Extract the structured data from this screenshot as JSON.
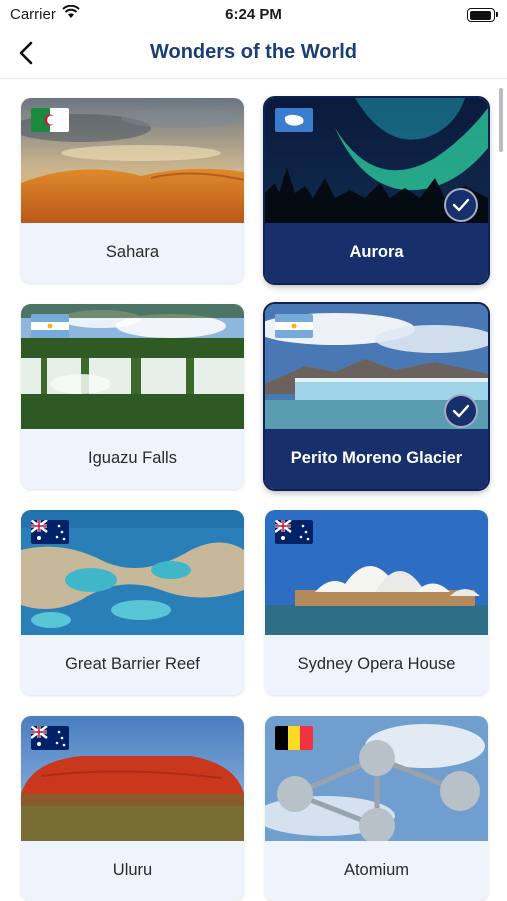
{
  "status_bar": {
    "carrier": "Carrier",
    "time": "6:24 PM"
  },
  "nav": {
    "title": "Wonders of the World"
  },
  "wonders": [
    {
      "label": "Sahara",
      "flag": "algeria-flag",
      "selected": false
    },
    {
      "label": "Aurora",
      "flag": "antarctica-flag",
      "selected": true
    },
    {
      "label": "Iguazu Falls",
      "flag": "argentina-flag",
      "selected": false
    },
    {
      "label": "Perito Moreno Glacier",
      "flag": "argentina-flag",
      "selected": true
    },
    {
      "label": "Great Barrier Reef",
      "flag": "australia-flag",
      "selected": false
    },
    {
      "label": "Sydney Opera House",
      "flag": "australia-flag",
      "selected": false
    },
    {
      "label": "Uluru",
      "flag": "australia-flag",
      "selected": false
    },
    {
      "label": "Atomium",
      "flag": "belgium-flag",
      "selected": false
    }
  ],
  "colors": {
    "title": "#1c3e78",
    "selected_card": "#17306b",
    "card": "#eef3fc"
  }
}
